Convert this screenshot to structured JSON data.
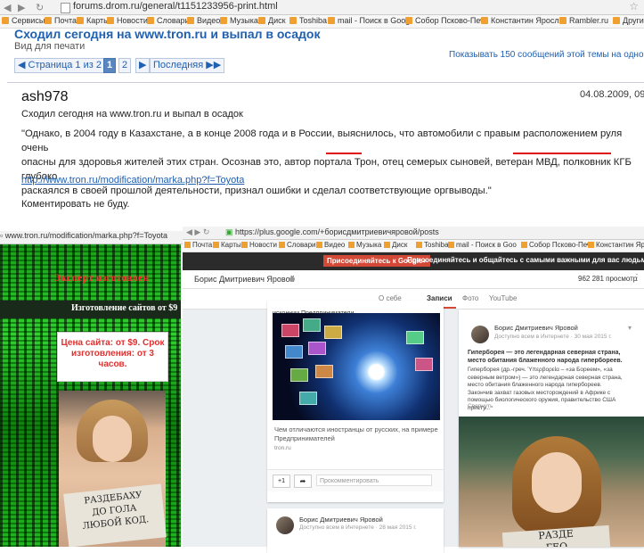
{
  "browser": {
    "url": "forums.drom.ru/general/t1151233956-print.html",
    "bookmarks": [
      "Сервисы",
      "Почта",
      "Карты",
      "Новости",
      "Словари",
      "Видео",
      "Музыка",
      "Диск",
      "Toshiba",
      "mail - Поиск в Goog",
      "Собор Псково-Печ",
      "Константин Яросла",
      "Rambler.ru",
      "Другие"
    ]
  },
  "forum": {
    "topic_title": "Сходил сегодня на www.tron.ru и выпал в осадок",
    "print_view": "Вид для печати",
    "pager": {
      "label": "Страница 1 из 2",
      "pages": [
        "1",
        "2"
      ],
      "next": "▶",
      "last": "Последняя"
    },
    "show_all": "Показывать 150 сообщений этой темы на одной стр",
    "post": {
      "author": "ash978",
      "date": "04.08.2009, 09",
      "subject": "Сходил сегодня на www.tron.ru и выпал в осадок",
      "body_l1": "\"Однако, в 2004 году в Казахстане, а в конце 2008 года и в России, выяснилось, что автомобили с правым расположением руля очень",
      "body_l2": "опасны для здоровья жителей этих стран. Осознав это, автор портала Трон, отец семерых сыновей, ветеран МВД, полковник КГБ глубоко",
      "body_l3": "раскаялся в своей прошлой деятельности, признал ошибки и сделал соответствующие оргвыводы.\"",
      "link": "http://www.tron.ru/modification/marka.php?f=Toyota",
      "comment": "Коментировать не буду."
    }
  },
  "tron_window": {
    "url": "www.tron.ru/modification/marka.php?f=Toyota",
    "banner": "Эксперт изготовлен",
    "dark_bar": "Изготовление сайтов от $9",
    "price_l1": "Цена сайта: от $9. Срок",
    "price_l2": "изготовления: от 3",
    "price_l3": "часов.",
    "sign_l1": "РАЗДЕБАХУ",
    "sign_l2": "ДО ГОЛА",
    "sign_l3": "ЛЮБОЙ КОД."
  },
  "gplus_window": {
    "url": "https://plus.google.com/+борисдмитриевичяровой/posts",
    "bookmarks": [
      "Почта",
      "Карты",
      "Новости",
      "Словари",
      "Видео",
      "Музыка",
      "Диск",
      "Toshiba",
      "mail - Поиск в Goo",
      "Собор Псково-Печ",
      "Константин Ярос"
    ],
    "join_button": "Присоединяйтесь к Google+",
    "slogan": "Присоединяйтесь и общайтесь с самыми важными для вас людьми",
    "profile_name": "Борис Дмитриевич Яровой",
    "views": "962 281 просмотр",
    "tabs": [
      "О себе",
      "Записи",
      "Фото",
      "YouTube"
    ],
    "card1": {
      "header": "исконнии Предприниматели",
      "desc": "Чем отличаются иностранцы от русских, на примере Предпринимателей",
      "site": "tron.ru",
      "plus_one": "+1",
      "comment_placeholder": "Прокомментировать"
    },
    "card2": {
      "name": "Борис Дмитриевич Яровой",
      "meta": "Доступно всем в Интернете · 28 мая 2015 г."
    },
    "card3": {
      "name": "Борис Дмитриевич Яровой",
      "meta": "Доступно всем в Интернете · 30 мая 2015 г.",
      "lead": "Гиперборея — это легендарная северная страна, место обитания блаженного народа гипербореев.",
      "text": "Гиперборея (др.-греч. Ὑπερβορεία – «за Бореем», «за северным ветром») — это легендарная северная страна, место обитания блаженного народа гипербореев. Закончив захват газовых месторождений в Африке с помощью биологического оружия, правительство США присту...",
      "collapse": "Свернуть",
      "sign_l1": "РАЗДЕ",
      "sign_l2": "ГЕО"
    }
  }
}
